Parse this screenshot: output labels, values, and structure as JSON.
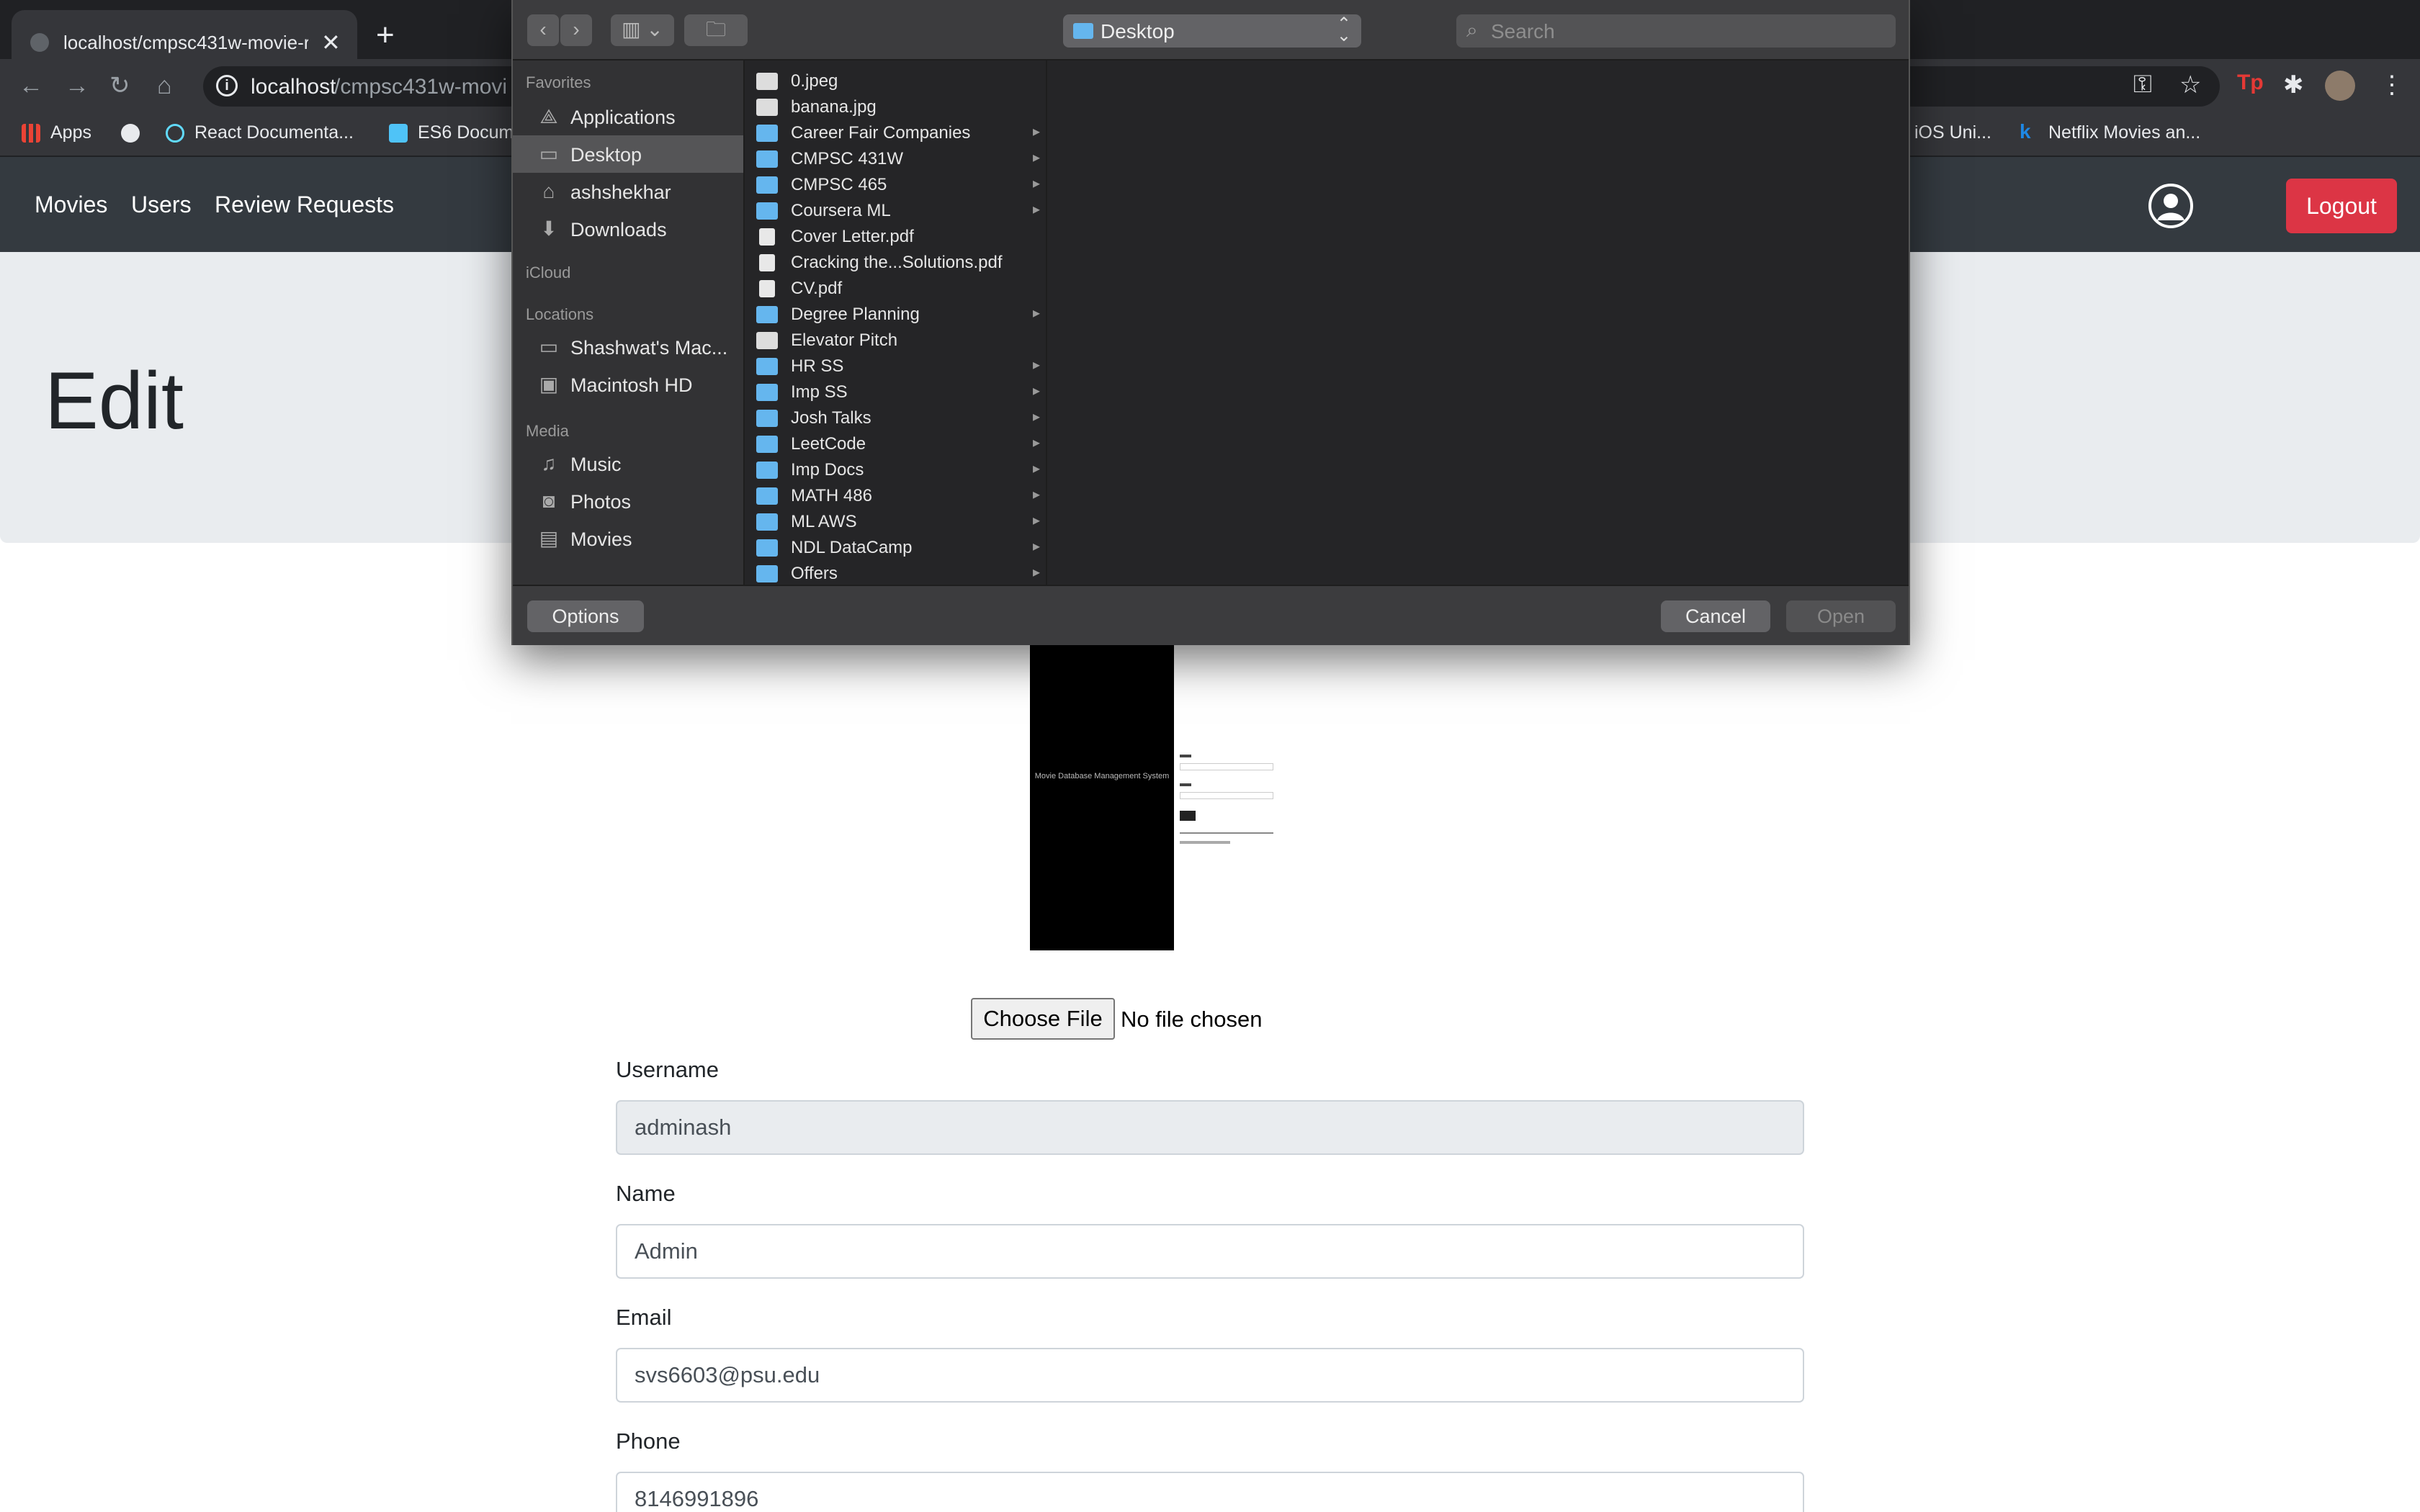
{
  "browser": {
    "tab_title": "localhost/cmpsc431w-movie-r",
    "url_host": "localhost",
    "url_path": "/cmpsc431w-movi",
    "bookmarks": [
      {
        "label": "Apps",
        "color": "#ea4335"
      },
      {
        "label": "",
        "color": "#e8eaed"
      },
      {
        "label": "React Documenta...",
        "color": "#61dafb"
      },
      {
        "label": "ES6 Docum",
        "color": "#4fc3f7"
      },
      {
        "label": "iOS Uni...",
        "color": ""
      },
      {
        "label": "Netflix Movies an...",
        "color": "#1e88e5"
      }
    ]
  },
  "nav": {
    "links": [
      "Movies",
      "Users",
      "Review Requests"
    ],
    "logout_label": "Logout"
  },
  "page": {
    "title": "Edit",
    "preview_caption": "Movie Database Management System",
    "choose_file_label": "Choose File",
    "no_file_text": "No file chosen"
  },
  "form": {
    "fields": [
      {
        "label": "Username",
        "value": "adminash",
        "readonly": true
      },
      {
        "label": "Name",
        "value": "Admin",
        "readonly": false
      },
      {
        "label": "Email",
        "value": "svs6603@psu.edu",
        "readonly": false
      },
      {
        "label": "Phone",
        "value": "8146991896",
        "readonly": false
      }
    ]
  },
  "dialog": {
    "location": "Desktop",
    "search_placeholder": "Search",
    "sidebar": {
      "favorites_heading": "Favorites",
      "favorites": [
        "Applications",
        "Desktop",
        "ashshekhar",
        "Downloads"
      ],
      "icloud_heading": "iCloud",
      "locations_heading": "Locations",
      "locations": [
        "Shashwat's Mac...",
        "Macintosh HD"
      ],
      "media_heading": "Media",
      "media": [
        "Music",
        "Photos",
        "Movies"
      ],
      "selected": "Desktop"
    },
    "files": [
      {
        "name": "0.jpeg",
        "type": "img",
        "folder": false
      },
      {
        "name": "banana.jpg",
        "type": "img",
        "folder": false
      },
      {
        "name": "Career Fair Companies",
        "type": "folder",
        "folder": true
      },
      {
        "name": "CMPSC 431W",
        "type": "folder",
        "folder": true
      },
      {
        "name": "CMPSC 465",
        "type": "folder",
        "folder": true
      },
      {
        "name": "Coursera ML",
        "type": "folder",
        "folder": true
      },
      {
        "name": "Cover Letter.pdf",
        "type": "doc",
        "folder": false
      },
      {
        "name": "Cracking the...Solutions.pdf",
        "type": "doc",
        "folder": false
      },
      {
        "name": "CV.pdf",
        "type": "doc",
        "folder": false
      },
      {
        "name": "Degree Planning",
        "type": "folder",
        "folder": true
      },
      {
        "name": "Elevator Pitch",
        "type": "img",
        "folder": false
      },
      {
        "name": "HR SS",
        "type": "folder",
        "folder": true
      },
      {
        "name": "Imp SS",
        "type": "folder",
        "folder": true
      },
      {
        "name": "Josh Talks",
        "type": "folder",
        "folder": true
      },
      {
        "name": "LeetCode",
        "type": "folder",
        "folder": true
      },
      {
        "name": "Imp Docs",
        "type": "folder",
        "folder": true
      },
      {
        "name": "MATH 486",
        "type": "folder",
        "folder": true
      },
      {
        "name": "ML AWS",
        "type": "folder",
        "folder": true
      },
      {
        "name": "NDL DataCamp",
        "type": "folder",
        "folder": true
      },
      {
        "name": "Offers",
        "type": "folder",
        "folder": true
      }
    ],
    "options_label": "Options",
    "cancel_label": "Cancel",
    "open_label": "Open"
  }
}
